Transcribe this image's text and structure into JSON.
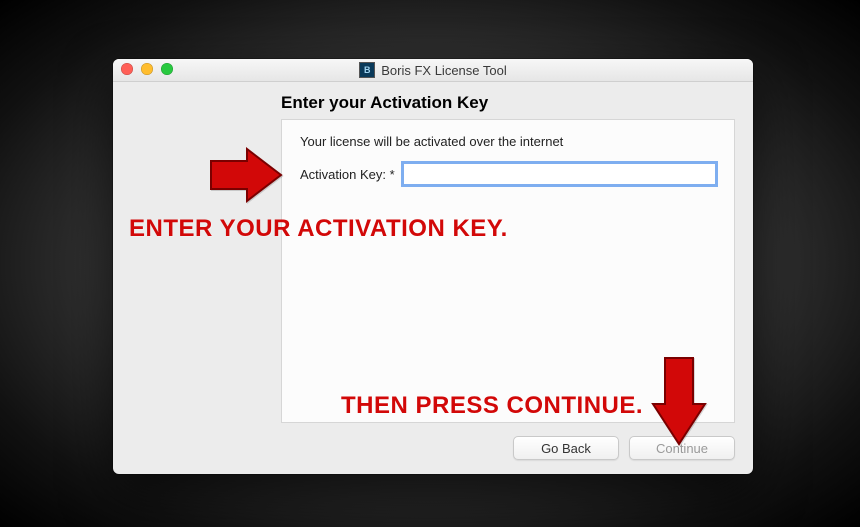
{
  "window": {
    "title": "Boris FX License Tool",
    "app_icon_letter": "B"
  },
  "heading": "Enter your Activation Key",
  "panel": {
    "info": "Your license will be activated over the internet",
    "field_label": "Activation Key: *",
    "field_value": ""
  },
  "buttons": {
    "back": "Go Back",
    "continue": "Continue"
  },
  "annotations": {
    "enter_key": "ENTER YOUR ACTIVATION KEY.",
    "press_continue": "THEN PRESS CONTINUE."
  },
  "colors": {
    "annotation_red": "#d20808",
    "focus_ring": "#7eaef0"
  }
}
